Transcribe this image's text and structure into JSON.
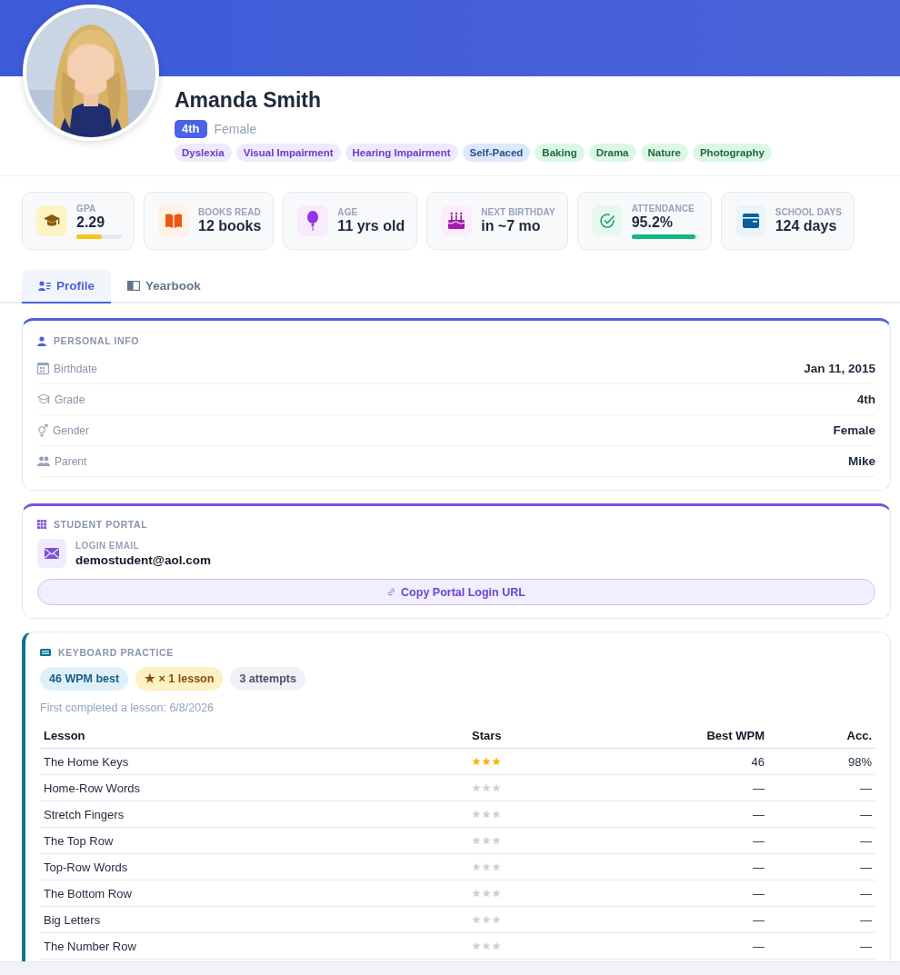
{
  "student": {
    "name": "Amanda Smith",
    "grade_badge": "4th",
    "gender": "Female",
    "tags": [
      {
        "label": "Dyslexia",
        "kind": "need"
      },
      {
        "label": "Visual Impairment",
        "kind": "need"
      },
      {
        "label": "Hearing Impairment",
        "kind": "need"
      },
      {
        "label": "Self-Paced",
        "kind": "pace"
      },
      {
        "label": "Baking",
        "kind": "interest"
      },
      {
        "label": "Drama",
        "kind": "interest"
      },
      {
        "label": "Nature",
        "kind": "interest"
      },
      {
        "label": "Photography",
        "kind": "interest"
      }
    ]
  },
  "stats": [
    {
      "kind": "gpa",
      "label": "GPA",
      "value": "2.29",
      "level": 0.55
    },
    {
      "kind": "books",
      "label": "BOOKS READ",
      "value": "12 books"
    },
    {
      "kind": "age",
      "label": "AGE",
      "value": "11 yrs old"
    },
    {
      "kind": "birthday",
      "label": "NEXT BIRTHDAY",
      "value": "in ~7 mo"
    },
    {
      "kind": "attendance",
      "label": "ATTENDANCE",
      "value": "95.2%",
      "level": 0.952
    },
    {
      "kind": "days",
      "label": "SCHOOL DAYS",
      "value": "124 days"
    }
  ],
  "tabs": [
    {
      "label": "Profile",
      "kind": "profile",
      "selected": true
    },
    {
      "label": "Yearbook",
      "kind": "yearbook",
      "selected": false
    }
  ],
  "personal_info": {
    "title": "PERSONAL INFO",
    "rows": [
      {
        "kind": "birthdate",
        "label": "Birthdate",
        "value": "Jan 11, 2015"
      },
      {
        "kind": "grade",
        "label": "Grade",
        "value": "4th"
      },
      {
        "kind": "gender",
        "label": "Gender",
        "value": "Female"
      },
      {
        "kind": "parent",
        "label": "Parent",
        "value": "Mike"
      }
    ]
  },
  "student_portal": {
    "title": "STUDENT PORTAL",
    "email_label": "LOGIN EMAIL",
    "email": "demostudent@aol.com",
    "copy_button": "Copy Portal Login URL"
  },
  "keyboard_practice": {
    "title": "KEYBOARD PRACTICE",
    "badges": [
      {
        "label": "46 WPM best",
        "kind": "wpm"
      },
      {
        "label": "★ × 1 lesson",
        "kind": "stars"
      },
      {
        "label": "3 attempts",
        "kind": "attempts"
      }
    ],
    "note": "First completed a lesson: 6/8/2026",
    "columns": [
      "Lesson",
      "Stars",
      "Best WPM",
      "Acc."
    ],
    "rows": [
      {
        "lesson": "The Home Keys",
        "stars": 3,
        "best_wpm": "46",
        "accuracy": "98%"
      },
      {
        "lesson": "Home-Row Words",
        "stars": 0,
        "best_wpm": "—",
        "accuracy": "—"
      },
      {
        "lesson": "Stretch Fingers",
        "stars": 0,
        "best_wpm": "—",
        "accuracy": "—"
      },
      {
        "lesson": "The Top Row",
        "stars": 0,
        "best_wpm": "—",
        "accuracy": "—"
      },
      {
        "lesson": "Top-Row Words",
        "stars": 0,
        "best_wpm": "—",
        "accuracy": "—"
      },
      {
        "lesson": "The Bottom Row",
        "stars": 0,
        "best_wpm": "—",
        "accuracy": "—"
      },
      {
        "lesson": "Big Letters",
        "stars": 0,
        "best_wpm": "—",
        "accuracy": "—"
      },
      {
        "lesson": "The Number Row",
        "stars": 0,
        "best_wpm": "—",
        "accuracy": "—"
      }
    ]
  }
}
